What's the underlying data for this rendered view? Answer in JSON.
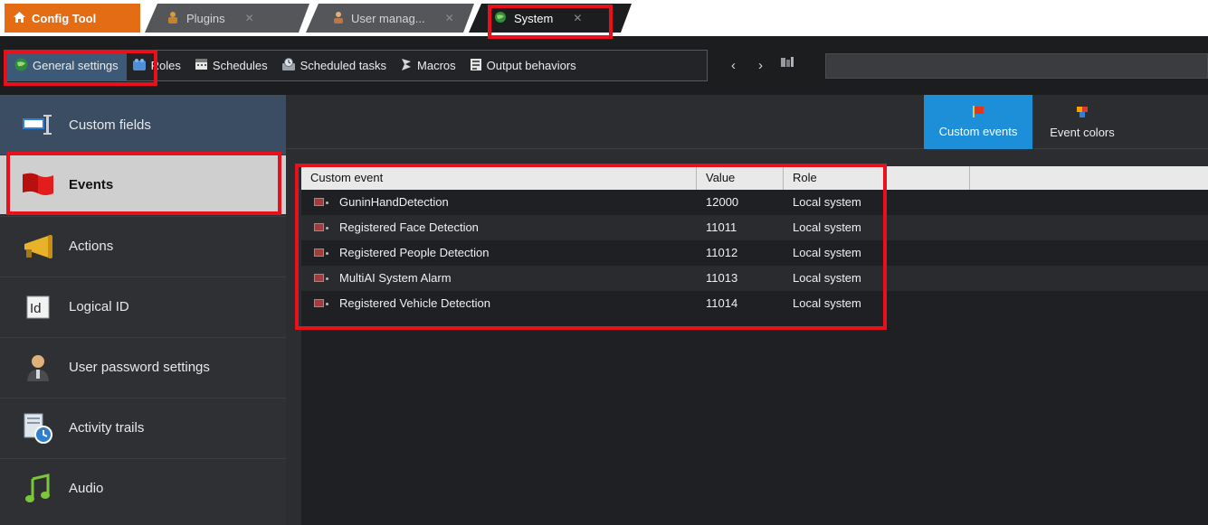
{
  "tabs": [
    {
      "label": "Config Tool",
      "icon": "home-icon"
    },
    {
      "label": "Plugins",
      "icon": "plugin-icon"
    },
    {
      "label": "User manag...",
      "icon": "user-icon"
    },
    {
      "label": "System",
      "icon": "system-globe-icon"
    }
  ],
  "toolbar": {
    "items": [
      {
        "label": "General settings",
        "icon": "globe-icon",
        "selected": true
      },
      {
        "label": "Roles",
        "icon": "roles-icon"
      },
      {
        "label": "Schedules",
        "icon": "calendar-icon"
      },
      {
        "label": "Scheduled tasks",
        "icon": "scheduled-task-icon"
      },
      {
        "label": "Macros",
        "icon": "macro-icon"
      },
      {
        "label": "Output behaviors",
        "icon": "output-behavior-icon"
      }
    ]
  },
  "sidebar": {
    "items": [
      {
        "label": "Custom fields",
        "icon": "custom-fields-icon"
      },
      {
        "label": "Events",
        "icon": "flag-icon",
        "active": true
      },
      {
        "label": "Actions",
        "icon": "megaphone-icon"
      },
      {
        "label": "Logical ID",
        "icon": "id-icon"
      },
      {
        "label": "User password settings",
        "icon": "user-password-icon"
      },
      {
        "label": "Activity trails",
        "icon": "activity-trails-icon"
      },
      {
        "label": "Audio",
        "icon": "music-note-icon"
      }
    ]
  },
  "view_tabs": [
    {
      "label": "Custom events",
      "icon": "flag-icon",
      "active": true
    },
    {
      "label": "Event colors",
      "icon": "event-colors-icon"
    }
  ],
  "table": {
    "columns": [
      "Custom event",
      "Value",
      "Role"
    ],
    "rows": [
      {
        "name": "GuninHandDetection",
        "value": "12000",
        "role": "Local system"
      },
      {
        "name": "Registered Face Detection",
        "value": "11011",
        "role": "Local system"
      },
      {
        "name": "Registered People Detection",
        "value": "11012",
        "role": "Local system"
      },
      {
        "name": "MultiAI System Alarm",
        "value": "11013",
        "role": "Local system"
      },
      {
        "name": "Registered Vehicle Detection",
        "value": "11014",
        "role": "Local system"
      }
    ]
  },
  "colors": {
    "accent": "#1d8fd8",
    "config_tab": "#e46c14",
    "highlight": "#e8101a"
  }
}
